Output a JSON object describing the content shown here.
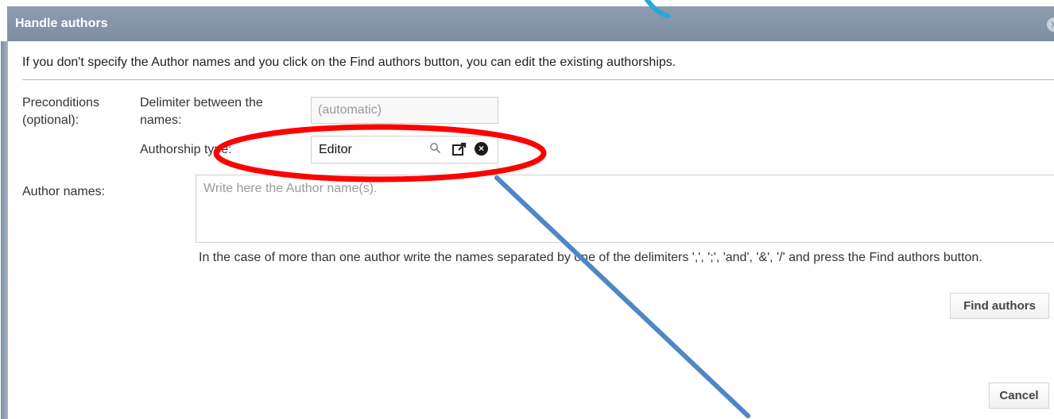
{
  "dialog": {
    "title": "Handle authors",
    "info_text": "If you don't specify the Author names and you click on the Find authors button, you can edit the existing authorships."
  },
  "preconditions": {
    "label": "Preconditions (optional):",
    "delimiter_label": "Delimiter between the names:",
    "delimiter_placeholder": "(automatic)",
    "authorship_label": "Authorship type:",
    "authorship_value": "Editor"
  },
  "author_names": {
    "label": "Author names:",
    "placeholder": "Write here the Author name(s).",
    "help_text": "In the case of more than one author write the names separated by one of the delimiters ',', ';', 'and', '&', '/' and press the Find authors button."
  },
  "buttons": {
    "find_authors": "Find authors",
    "cancel": "Cancel"
  },
  "colors": {
    "title_bar": "#7f8ea3",
    "highlight": "#ff0000",
    "arrow": "#4f86c6"
  },
  "icons": {
    "search": "search-icon",
    "open": "open-external-icon",
    "clear": "clear-icon",
    "close": "close-icon"
  }
}
